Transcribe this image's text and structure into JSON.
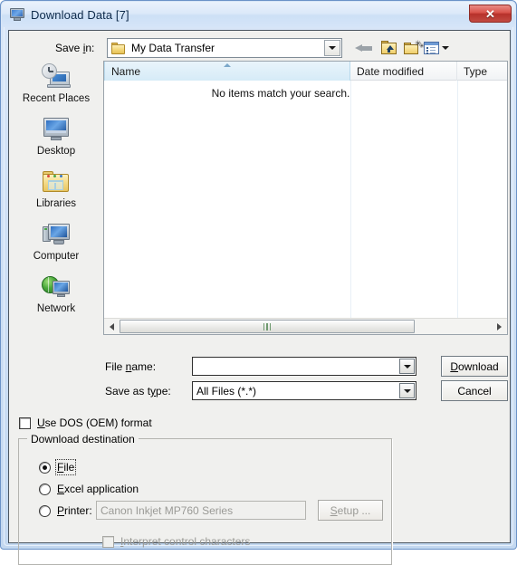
{
  "window": {
    "title": "Download Data [7]",
    "title_icon": "computer-monitor-icon",
    "close_label": "✕",
    "accent_blue": "#cfe0f5",
    "close_red": "#b6312b"
  },
  "toolbar": {
    "save_in_label_pre": "Save ",
    "save_in_label_accel": "i",
    "save_in_label_post": "n:",
    "save_in_value": "My Data Transfer",
    "buttons": [
      {
        "name": "back-button",
        "icon": "arrow-left-icon"
      },
      {
        "name": "up-one-level-button",
        "icon": "folder-up-icon"
      },
      {
        "name": "new-folder-button",
        "icon": "folder-new-icon"
      },
      {
        "name": "views-button",
        "icon": "views-list-icon"
      }
    ]
  },
  "places": [
    {
      "label": "Recent Places",
      "icon": "recent-places-icon"
    },
    {
      "label": "Desktop",
      "icon": "desktop-icon"
    },
    {
      "label": "Libraries",
      "icon": "libraries-icon"
    },
    {
      "label": "Computer",
      "icon": "computer-icon"
    },
    {
      "label": "Network",
      "icon": "network-icon"
    }
  ],
  "filelist": {
    "columns": [
      {
        "label": "Name",
        "sorted": true,
        "sort_direction": "ascending"
      },
      {
        "label": "Date modified",
        "sorted": false
      },
      {
        "label": "Type",
        "sorted": false
      }
    ],
    "rows": [],
    "empty_message": "No items match your search."
  },
  "filename": {
    "label_pre": "File ",
    "label_accel": "n",
    "label_post": "ame:",
    "value": "",
    "placeholder": ""
  },
  "savetype": {
    "label_pre": "Save as t",
    "label_accel": "y",
    "label_post": "pe:",
    "value": "All Files (*.*)"
  },
  "buttons": {
    "download_pre": "",
    "download_accel": "D",
    "download_post": "ownload",
    "cancel": "Cancel"
  },
  "dos_checkbox": {
    "label_pre": "",
    "label_accel": "U",
    "label_post": "se DOS (OEM) format",
    "checked": false
  },
  "destination": {
    "title": "Download destination",
    "options": [
      {
        "label_pre": "",
        "label_accel": "F",
        "label_post": "ile",
        "selected": true,
        "focused": true,
        "disabled": false
      },
      {
        "label_pre": "",
        "label_accel": "E",
        "label_post": "xcel application",
        "selected": false,
        "focused": false,
        "disabled": false
      },
      {
        "label_pre": "",
        "label_accel": "P",
        "label_post": "rinter:",
        "selected": false,
        "focused": false,
        "disabled": false
      }
    ],
    "printer_value": "Canon Inkjet MP760 Series",
    "setup_pre": "",
    "setup_accel": "S",
    "setup_post": "etup ...",
    "interpret_pre": "",
    "interpret_accel": "I",
    "interpret_post": "nterpret control characters",
    "interpret_checked": false
  }
}
